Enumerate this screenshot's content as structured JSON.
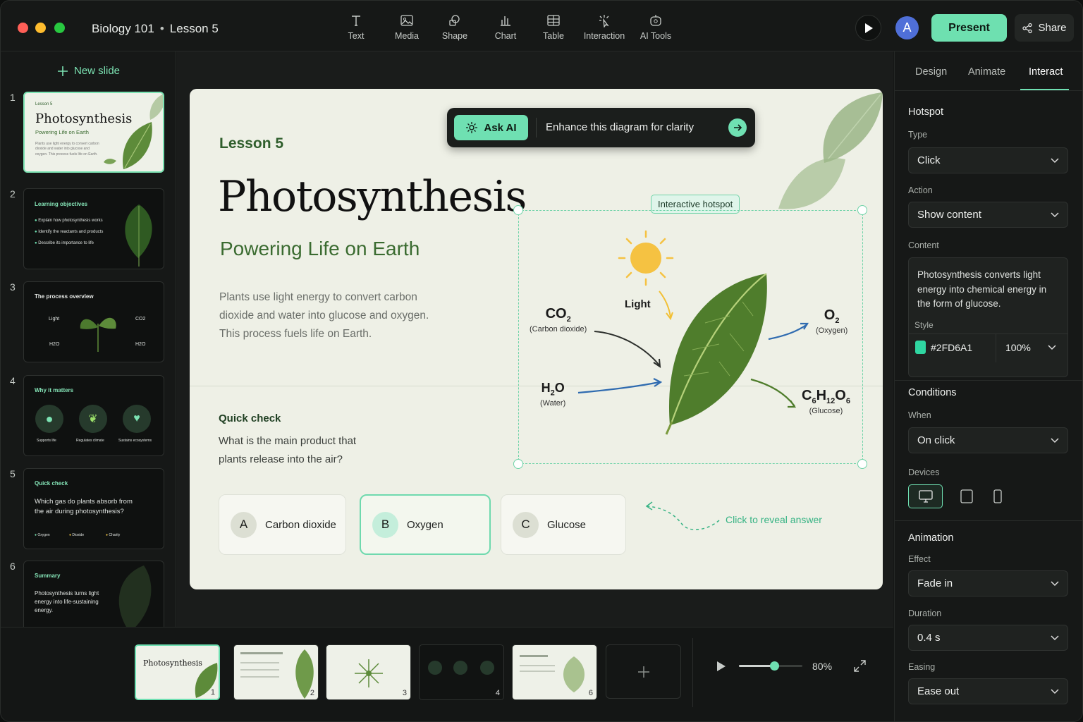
{
  "window": {
    "title": "Biology 101",
    "subtitle": "Lesson 5"
  },
  "toolbar": {
    "tools": [
      "Text",
      "Media",
      "Shape",
      "Chart",
      "Table",
      "Interaction",
      "AI Tools"
    ],
    "avatar_initial": "A",
    "present_label": "Present",
    "share_label": "Share"
  },
  "sidebar": {
    "new_slide_label": "New slide",
    "slides": [
      {
        "num": "1",
        "kicker": "Lesson 5",
        "title": "Photosynthesis",
        "subtitle": "Powering Life on Earth",
        "body": "Plants use light energy to convert carbon dioxide and water into glucose and oxygen. This process fuels life on Earth."
      },
      {
        "num": "2",
        "title": "Learning objectives",
        "items": [
          "Explain how photosynthesis works",
          "Identify the reactants and products",
          "Describe its importance to life"
        ]
      },
      {
        "num": "3",
        "title": "The process overview",
        "labels": [
          "Light",
          "CO2",
          "H2O",
          "H2O"
        ]
      },
      {
        "num": "4",
        "title": "Why it matters",
        "items": [
          "Supports life",
          "Regulates climate",
          "Sustains ecosystems"
        ]
      },
      {
        "num": "5",
        "title": "Quick check",
        "body": "Which gas do plants absorb from the air during photosynthesis?",
        "options": [
          "Oxygen",
          "Dioxide",
          "Charity"
        ]
      },
      {
        "num": "6",
        "title": "Summary",
        "body": "Photosynthesis turns light energy into life-sustaining energy."
      }
    ]
  },
  "slide": {
    "lesson": "Lesson 5",
    "title": "Photosynthesis",
    "subtitle": "Powering Life on Earth",
    "body": "Plants use light energy to convert carbon dioxide and water into glucose and oxygen. This process fuels life on Earth.",
    "ask_ai": {
      "button": "Ask AI",
      "prompt": "Enhance this diagram for clarity"
    },
    "hotspot_tag": "Interactive hotspot",
    "diagram": {
      "light": "Light",
      "co2": {
        "formula": "CO2",
        "name": "(Carbon dioxide)"
      },
      "h2o": {
        "formula": "H2O",
        "name": "(Water)"
      },
      "o2": {
        "formula": "O2",
        "name": "(Oxygen)"
      },
      "glucose": {
        "formula": "C6H12O6",
        "name": "(Glucose)"
      }
    },
    "quick_check": {
      "label": "Quick check",
      "question": "What is the main product that plants release into the air?",
      "options": [
        {
          "letter": "A",
          "text": "Carbon dioxide"
        },
        {
          "letter": "B",
          "text": "Oxygen",
          "selected": true
        },
        {
          "letter": "C",
          "text": "Glucose"
        }
      ],
      "reveal_hint": "Click to reveal answer"
    }
  },
  "panel": {
    "tabs": [
      "Design",
      "Animate",
      "Interact"
    ],
    "active_tab": "Interact",
    "hotspot": {
      "heading": "Hotspot",
      "type_label": "Type",
      "type_value": "Click",
      "action_label": "Action",
      "action_value": "Show content",
      "content_label": "Content",
      "content_text": "Photosynthesis converts light energy into chemical energy in the form of glucose.",
      "style_label": "Style",
      "style_color": "#2FD6A1",
      "style_opacity": "100%"
    },
    "conditions": {
      "heading": "Conditions",
      "when_label": "When",
      "when_value": "On click",
      "devices_label": "Devices"
    },
    "animation": {
      "heading": "Animation",
      "effect_label": "Effect",
      "effect_value": "Fade in",
      "duration_label": "Duration",
      "duration_value": "0.4 s",
      "easing_label": "Easing",
      "easing_value": "Ease out"
    }
  },
  "bottom": {
    "thumbs": [
      "1",
      "2",
      "3",
      "4",
      "6"
    ],
    "zoom": "80%",
    "zoom_level": 0.55
  },
  "colors": {
    "accent": "#6EE0B0",
    "hotspot": "#2FD6A1"
  }
}
